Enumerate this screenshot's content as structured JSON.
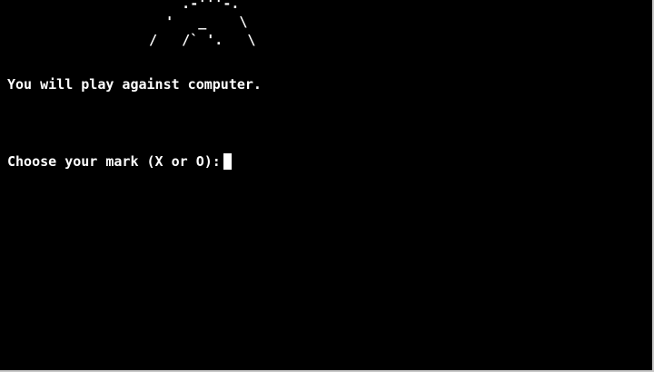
{
  "terminal": {
    "ascii_art": [
      "      .-'''-.",
      "    '   _    \\",
      "  /   /` '.   \\"
    ],
    "info_line": "You will play against computer.",
    "prompt_line": "Choose your mark (X or O):",
    "input_value": ""
  },
  "colors": {
    "background": "#000000",
    "foreground": "#ffffff",
    "border": "#c8c8c8"
  }
}
